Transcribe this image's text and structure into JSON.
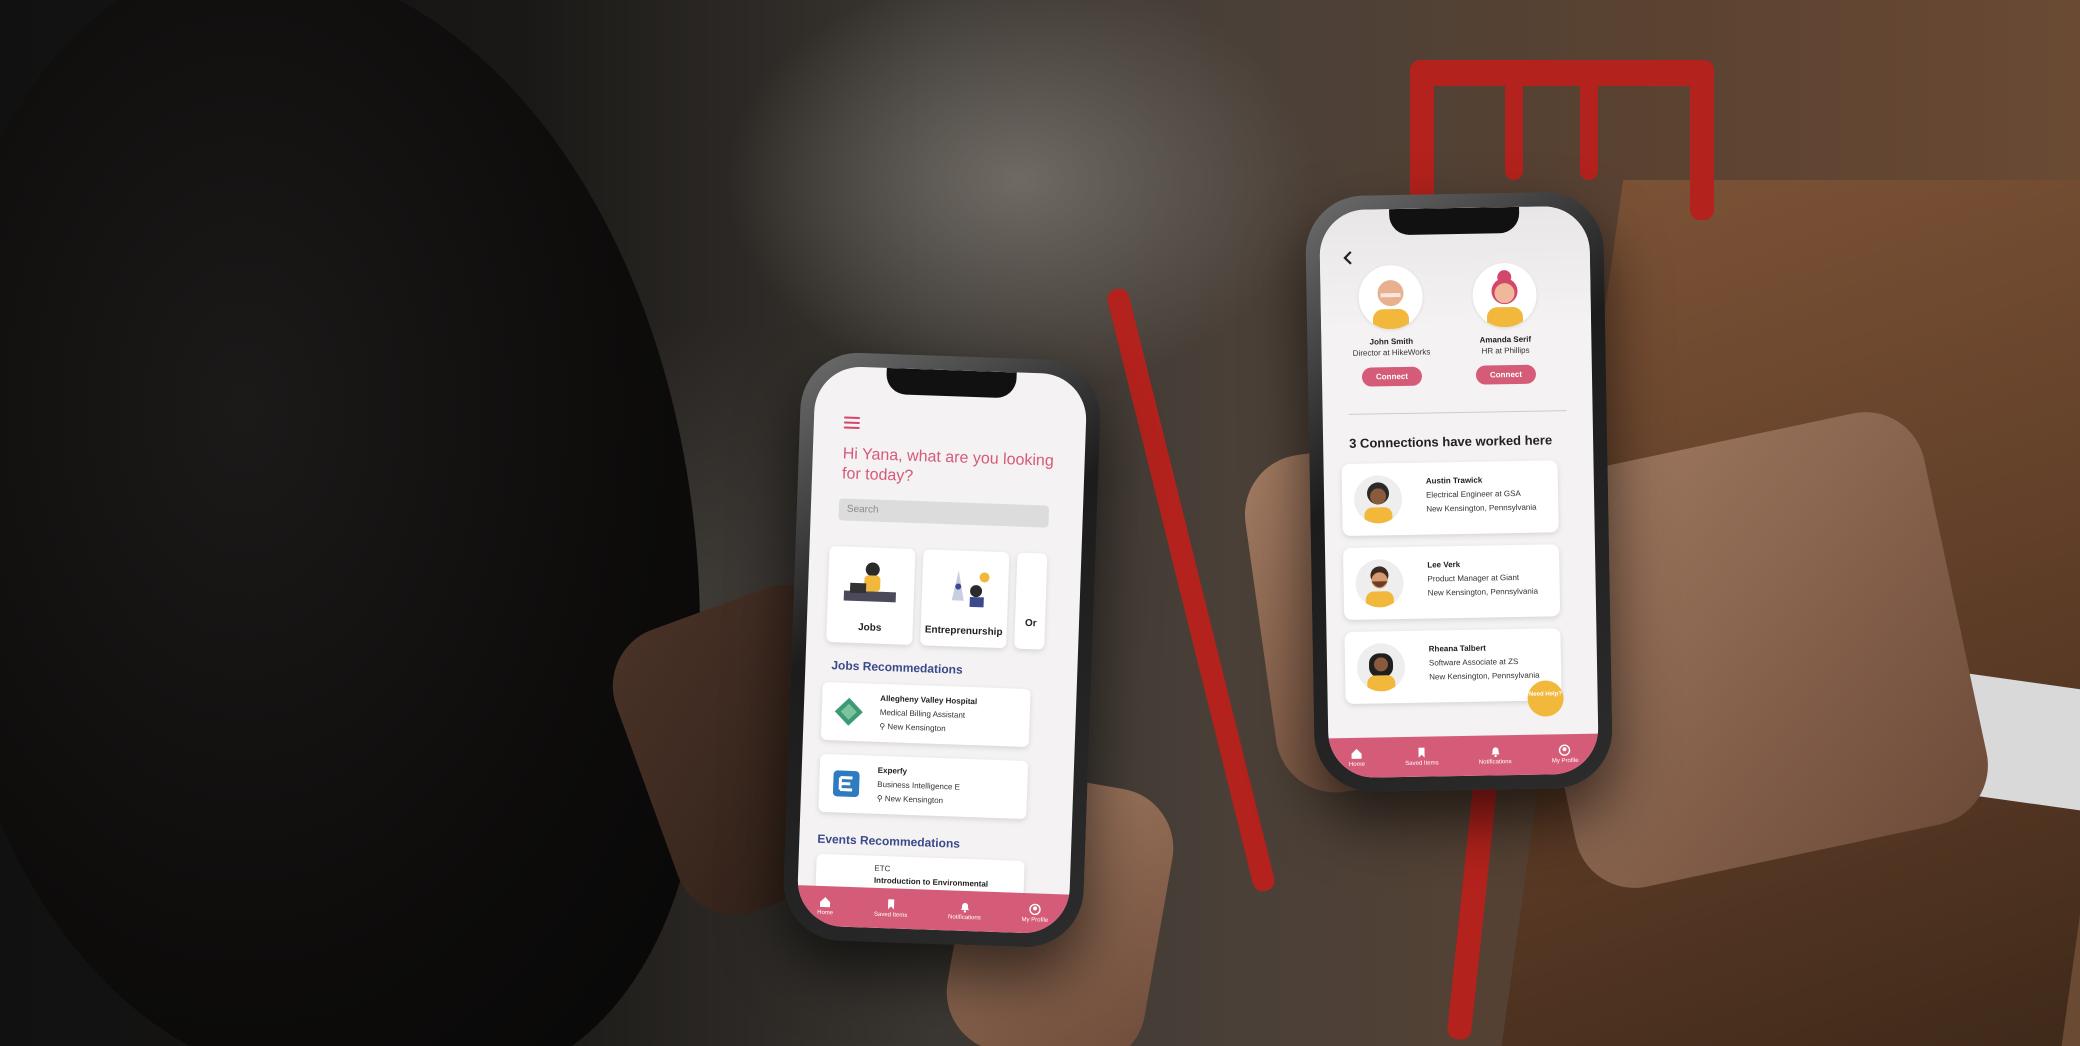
{
  "home_screen": {
    "greeting": "Hi Yana, what are you looking for today?",
    "search_placeholder": "Search",
    "categories": [
      {
        "label": "Jobs"
      },
      {
        "label": "Entreprenurship"
      },
      {
        "label": "Or"
      }
    ],
    "jobs_section_title": "Jobs Recommedations",
    "jobs": [
      {
        "company": "Allegheny Valley Hospital",
        "title": "Medical Billing Assistant",
        "location": "New Kensington"
      },
      {
        "company": "Experfy",
        "title": "Business Intelligence E",
        "location": "New Kensington"
      }
    ],
    "events_section_title": "Events Recommedations",
    "events": [
      {
        "org": "ETC",
        "title": "Introduction to Environmental"
      }
    ],
    "tabs": [
      {
        "label": "Home"
      },
      {
        "label": "Saved Items"
      },
      {
        "label": "Notifications"
      },
      {
        "label": "My Profile"
      }
    ]
  },
  "company_screen": {
    "featured": [
      {
        "name": "John Smith",
        "role": "Director at HikeWorks",
        "button": "Connect"
      },
      {
        "name": "Amanda Serif",
        "role": "HR at Phillips",
        "button": "Connect"
      }
    ],
    "connections_title": "3 Connections have worked here",
    "connections": [
      {
        "name": "Austin Trawick",
        "role": "Electrical Engineer at GSA",
        "location": "New Kensington, Pennsylvania"
      },
      {
        "name": "Lee Verk",
        "role": "Product Manager at Giant",
        "location": "New Kensington, Pennsylvania"
      },
      {
        "name": "Rheana Talbert",
        "role": "Software Associate at ZS",
        "location": "New Kensington, Pennsylvania"
      }
    ],
    "help_label": "Need Help?",
    "tabs": [
      {
        "label": "Home"
      },
      {
        "label": "Saved Items"
      },
      {
        "label": "Notifications"
      },
      {
        "label": "My Profile"
      }
    ]
  },
  "colors": {
    "accent": "#d55c78",
    "section_blue": "#3a4a8a",
    "help_yellow": "#f2b83c"
  }
}
